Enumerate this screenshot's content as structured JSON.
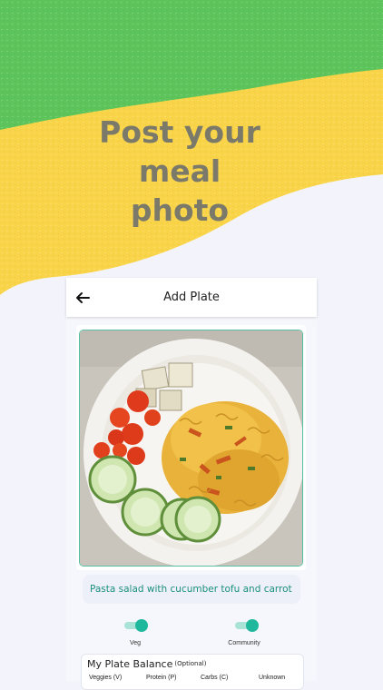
{
  "headline": {
    "line1": "Post your",
    "line2": "meal",
    "line3": "photo"
  },
  "colors": {
    "green_band": "#5cc45a",
    "yellow_band": "#f9d449",
    "background": "#f3f4fb",
    "accent": "#1fb89d",
    "caption_text": "#1d8f7f",
    "headline_text": "#7b7a6a"
  },
  "app_bar": {
    "back_icon": "arrow-left-icon",
    "title": "Add Plate"
  },
  "photo": {
    "description_icon": "meal-photo"
  },
  "caption": {
    "text": "Pasta salad with cucumber tofu and carrot"
  },
  "toggles": {
    "veg": {
      "label": "Veg",
      "on": true
    },
    "community": {
      "label": "Community",
      "on": true
    }
  },
  "plate_balance": {
    "title": "My Plate Balance",
    "optional": "(Optional)",
    "columns": [
      "Veggies (V)",
      "Protein (P)",
      "Carbs (C)",
      "Unknown"
    ]
  }
}
